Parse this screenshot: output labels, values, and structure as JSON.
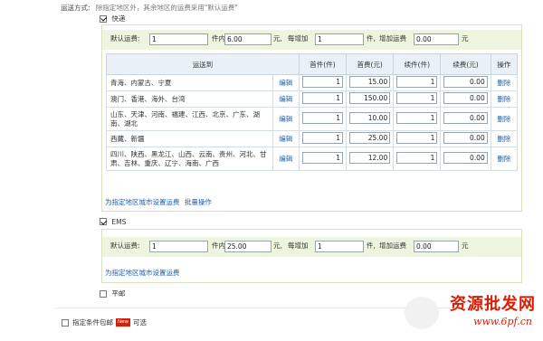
{
  "header": {
    "label": "运送方式:",
    "hint": "除指定地区外，其余地区的运费采用\"默认运费\""
  },
  "express": {
    "checkbox_label": "快递",
    "checked": true,
    "default": {
      "label_prefix": "默认运费:",
      "first_qty": "1",
      "unit_text_1": "件内,",
      "first_fee": "6.00",
      "unit_text_2": "元,",
      "add_text": "每增加",
      "add_qty": "1",
      "unit_text_3": "件,",
      "add_fee_text": "增加运费",
      "add_fee": "0.00",
      "unit_text_4": "元"
    },
    "table": {
      "headers": [
        "运送到",
        "首件(件)",
        "首费(元)",
        "续件(件)",
        "续费(元)",
        "操作"
      ],
      "edit_label": "编辑",
      "delete_label": "删除",
      "rows": [
        {
          "region": "青海、内蒙古、宁夏",
          "first_qty": "1",
          "first_fee": "15.00",
          "add_qty": "1",
          "add_fee": "0.00"
        },
        {
          "region": "澳门、香港、海外、台湾",
          "first_qty": "1",
          "first_fee": "150.00",
          "add_qty": "1",
          "add_fee": "0.00"
        },
        {
          "region": "山东、天津、河南、福建、江西、北京、广东、湖南、湖北",
          "first_qty": "1",
          "first_fee": "10.00",
          "add_qty": "1",
          "add_fee": "0.00"
        },
        {
          "region": "西藏、新疆",
          "first_qty": "1",
          "first_fee": "25.00",
          "add_qty": "1",
          "add_fee": "0.00"
        },
        {
          "region": "四川、陕西、黑龙江、山西、云南、贵州、河北、甘肃、吉林、重庆、辽宁、海南、广西",
          "first_qty": "1",
          "first_fee": "12.00",
          "add_qty": "1",
          "add_fee": "0.00"
        }
      ]
    },
    "links": {
      "set_city": "为指定地区城市设置运费",
      "batch": "批量操作"
    }
  },
  "ems": {
    "checkbox_label": "EMS",
    "checked": true,
    "default": {
      "label_prefix": "默认运费:",
      "first_qty": "1",
      "unit_text_1": "件内,",
      "first_fee": "25.00",
      "unit_text_2": "元,",
      "add_text": "每增加",
      "add_qty": "1",
      "unit_text_3": "件,",
      "add_fee_text": "增加运费",
      "add_fee": "0.00",
      "unit_text_4": "元"
    },
    "link": "为指定地区城市设置运费"
  },
  "post": {
    "checkbox_label": "平邮",
    "checked": false
  },
  "footer": {
    "label": "指定条件包邮",
    "badge": "New",
    "suffix": "可选"
  },
  "watermark": {
    "cn": "资源批发网",
    "en": "www.6pf.cn"
  },
  "colors": {
    "link": "#1f5fa8",
    "panel_bg": "#eef5df",
    "badge": "#d81e06"
  }
}
